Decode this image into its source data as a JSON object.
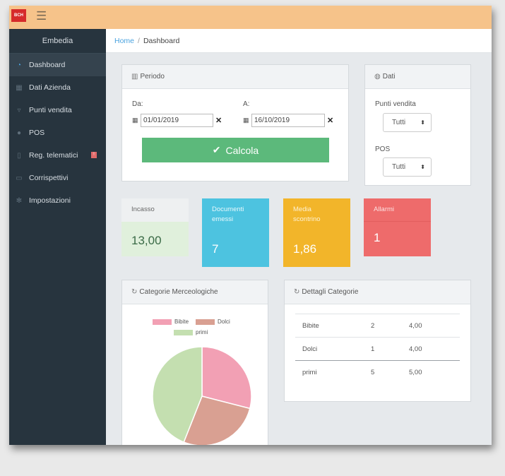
{
  "topbar": {
    "logo_text": "BCH",
    "menu_icon": "hamburger-icon",
    "bg_color": "#f6c38a"
  },
  "sidebar": {
    "brand": "Embedia",
    "items": [
      {
        "label": "Dashboard",
        "icon": "dashboard-icon"
      },
      {
        "label": "Dati Azienda",
        "icon": "building-icon"
      },
      {
        "label": "Punti vendita",
        "icon": "store-icon"
      },
      {
        "label": "POS",
        "icon": "pos-icon"
      },
      {
        "label": "Reg. telematici",
        "icon": "register-icon",
        "badge": "!"
      },
      {
        "label": "Corrispettivi",
        "icon": "receipt-icon"
      },
      {
        "label": "Impostazioni",
        "icon": "settings-icon"
      }
    ]
  },
  "breadcrumb": {
    "home": "Home",
    "separator": "/",
    "current": "Dashboard"
  },
  "periodo": {
    "title": "Periodo",
    "from_label": "Da:",
    "from_value": "01/01/2019",
    "to_label": "A:",
    "to_value": "16/10/2019",
    "calc_button": "Calcola"
  },
  "dati": {
    "title": "Dati",
    "punti_label": "Punti vendita",
    "punti_value": "Tutti",
    "pos_label": "POS",
    "pos_value": "Tutti"
  },
  "cards": [
    {
      "title": "Incasso",
      "value": "13,00",
      "color": "#5cb97b"
    },
    {
      "title": "Documenti emessi",
      "value": "7",
      "color": "#4dc3e0"
    },
    {
      "title": "Media scontrino",
      "value": "1,86",
      "color": "#f2b52a"
    },
    {
      "title": "Allarmi",
      "value": "1",
      "color": "#ee6b6b"
    }
  ],
  "categorie": {
    "title": "Categorie Merceologiche"
  },
  "dettagli": {
    "title": "Dettagli Categorie",
    "rows": [
      {
        "name": "Bibite",
        "qty": "2",
        "amount": "4,00"
      },
      {
        "name": "Dolci",
        "qty": "1",
        "amount": "4,00"
      },
      {
        "name": "primi",
        "qty": "5",
        "amount": "5,00"
      }
    ]
  },
  "chart_data": {
    "type": "pie",
    "categories": [
      "Bibite",
      "Dolci",
      "primi"
    ],
    "values": [
      29,
      27,
      44
    ],
    "colors": [
      "#f2a0b4",
      "#d9a092",
      "#c4dfb0"
    ],
    "legend_position": "top"
  }
}
